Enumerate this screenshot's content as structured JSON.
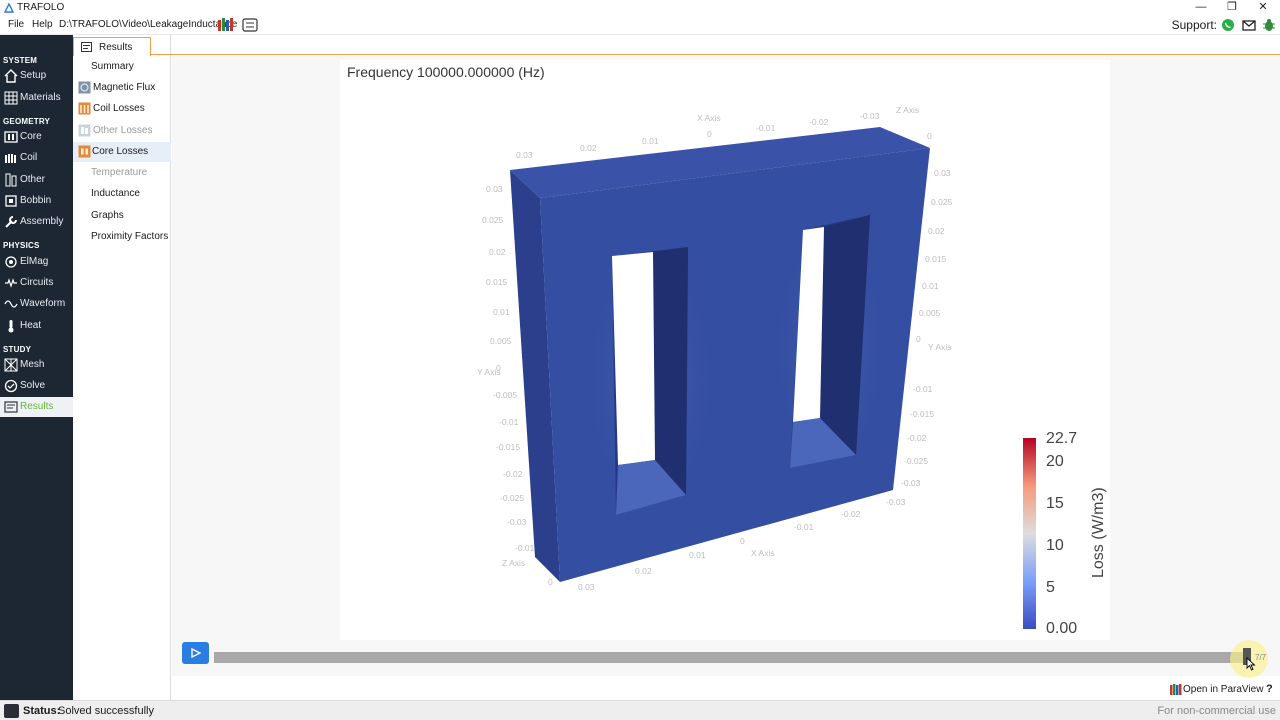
{
  "window": {
    "title": "TRAFOLO"
  },
  "menu": {
    "file": "File",
    "help": "Help",
    "project_path": "D:\\TRAFOLO\\Video\\LeakageInductance"
  },
  "support": {
    "label": "Support:"
  },
  "sidebar": {
    "sections": [
      {
        "title": "SYSTEM",
        "items": [
          {
            "label": "Setup",
            "icon": "house-icon"
          },
          {
            "label": "Materials",
            "icon": "grid-icon"
          }
        ]
      },
      {
        "title": "GEOMETRY",
        "items": [
          {
            "label": "Core",
            "icon": "core-icon"
          },
          {
            "label": "Coil",
            "icon": "coil-icon"
          },
          {
            "label": "Other",
            "icon": "other-icon"
          },
          {
            "label": "Bobbin",
            "icon": "bobbin-icon"
          },
          {
            "label": "Assembly",
            "icon": "wrench-icon"
          }
        ]
      },
      {
        "title": "PHYSICS",
        "items": [
          {
            "label": "ElMag",
            "icon": "magnet-icon"
          },
          {
            "label": "Circuits",
            "icon": "circuit-icon"
          },
          {
            "label": "Waveform",
            "icon": "wave-icon"
          },
          {
            "label": "Heat",
            "icon": "thermometer-icon"
          }
        ]
      },
      {
        "title": "STUDY",
        "items": [
          {
            "label": "Mesh",
            "icon": "mesh-icon"
          },
          {
            "label": "Solve",
            "icon": "solve-icon"
          },
          {
            "label": "Results",
            "icon": "results-icon",
            "active": true
          }
        ]
      }
    ]
  },
  "results_panel": {
    "tab_label": "Results",
    "items": [
      {
        "label": "Summary",
        "enabled": true
      },
      {
        "label": "Magnetic Flux",
        "enabled": true,
        "icon": "flux-icon"
      },
      {
        "label": "Coil Losses",
        "enabled": true,
        "icon": "coil-loss-icon"
      },
      {
        "label": "Other Losses",
        "enabled": false,
        "icon": "other-loss-icon"
      },
      {
        "label": "Core Losses",
        "enabled": true,
        "selected": true,
        "icon": "core-loss-icon"
      },
      {
        "label": "Temperature",
        "enabled": false
      },
      {
        "label": "Inductance",
        "enabled": true
      },
      {
        "label": "Graphs",
        "enabled": true
      },
      {
        "label": "Proximity Factors",
        "enabled": true
      }
    ]
  },
  "viewer": {
    "title": "Frequency 100000.000000 (Hz)",
    "colorbar": {
      "title": "Loss (W/m3)",
      "max_label": "22.7",
      "ticks": [
        "20",
        "15",
        "10",
        "5"
      ],
      "min_label": "0.00"
    },
    "axes": {
      "x_axis_label": "X Axis",
      "y_axis_label": "Y Axis",
      "z_axis_label": "Z Axis",
      "top_x_ticks": [
        "0.03",
        "0.02",
        "0.01",
        "0",
        "-0.01",
        "-0.02",
        "-0.03",
        "0"
      ],
      "left_y_ticks": [
        "0.03",
        "0.025",
        "0.02",
        "0.015",
        "0.01",
        "0.005",
        "0",
        "-0.005",
        "-0.01",
        "-0.015",
        "-0.02",
        "-0.025",
        "-0.03",
        "-0.01",
        "0"
      ],
      "right_y_ticks": [
        "0.03",
        "0.025",
        "0.02",
        "0.015",
        "0.01",
        "0.005",
        "0",
        "-0.01",
        "-0.015",
        "-0.02",
        "-0.025",
        "-0.03"
      ],
      "bottom_x_ticks": [
        "0.03",
        "0.02",
        "0.01",
        "0",
        "-0.01",
        "-0.02",
        "-0.03"
      ]
    },
    "timeline": {
      "step_label": "7/7",
      "progress": 1.0
    }
  },
  "footer": {
    "paraview_label": "Open in ParaView",
    "help_label": "?"
  },
  "status": {
    "key": "Status:",
    "value": "Solved successfully",
    "license": "For non-commercial use"
  },
  "colors": {
    "sidebar_bg": "#1d2733",
    "accent_orange": "#f0a04b",
    "active_green": "#6bb13a",
    "play_blue": "#2a7de1",
    "core_blue": "#344ea1"
  }
}
